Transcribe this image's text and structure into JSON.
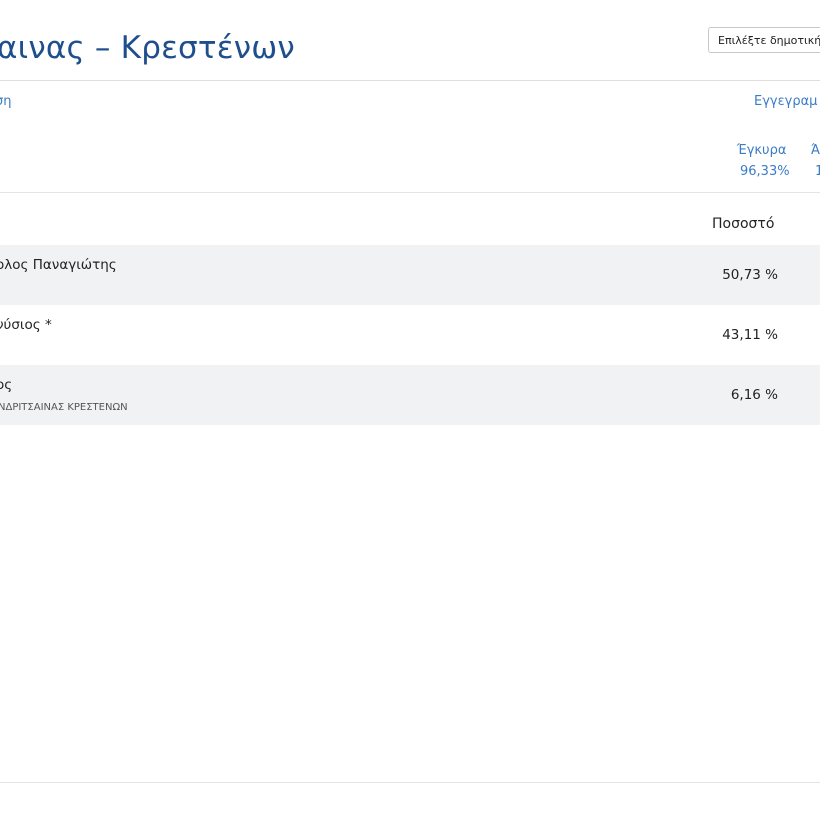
{
  "header": {
    "title": "αινας – Κρεστένων",
    "municipality_select": "Επιλέξτε δημοτική"
  },
  "links": {
    "left": "ση",
    "right": "Εγγεγραμ"
  },
  "stats": [
    {
      "label": "Έγκυρα",
      "value": "96,33%"
    },
    {
      "label": "Ά",
      "value": "1"
    }
  ],
  "table": {
    "column_percentage": "Ποσοστό",
    "rows": [
      {
        "name": "ολος Παναγιώτης",
        "party": "",
        "percentage": "50,73 %"
      },
      {
        "name": "νύσιος *",
        "party": "",
        "percentage": "43,11 %"
      },
      {
        "name": "ος",
        "party": "ΝΔΡΙΤΣΑΙΝΑΣ ΚΡΕΣΤΕΝΩΝ",
        "percentage": "6,16 %"
      }
    ]
  }
}
